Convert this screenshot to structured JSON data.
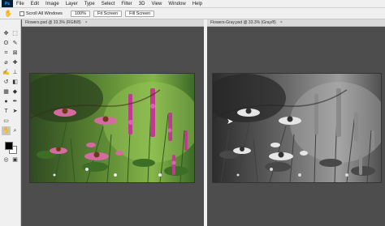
{
  "menubar": {
    "logo": "Ps",
    "items": [
      "File",
      "Edit",
      "Image",
      "Layer",
      "Type",
      "Select",
      "Filter",
      "3D",
      "View",
      "Window",
      "Help"
    ]
  },
  "options": {
    "scroll_all_label": "Scroll All Windows",
    "zoom_value": "100%",
    "fit_screen_label": "Fit Screen",
    "fill_screen_label": "Fill Screen"
  },
  "documents": {
    "left_tab": "Flowers.psd @ 33.3% (RGB/8)",
    "right_tab": "Flowers-Gray.psd @ 33.3% (Gray/8)",
    "close_glyph": "×"
  },
  "colors": {
    "workspace": "#4d4d4d",
    "panel": "#f0f0f0",
    "accent": "#31a8ff"
  }
}
